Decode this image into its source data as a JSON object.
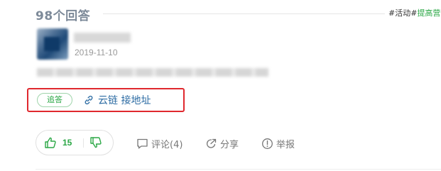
{
  "header": {
    "answers_title": "98个回答",
    "topic_activity": "#活动#",
    "topic_more": "提高营"
  },
  "answer": {
    "date": "2019-11-10",
    "follow_tag": "追答",
    "link_text": "云链 接地址"
  },
  "actions": {
    "upvote_count": "15",
    "comment_label": "评论(4)",
    "share_label": "分享",
    "report_label": "举报"
  },
  "colors": {
    "accent_green": "#2aa745",
    "link_blue": "#2e6da4",
    "highlight_red": "#e0282e",
    "title_gray": "#7d8a99"
  },
  "icons": {
    "link": "link-icon",
    "upvote": "thumbs-up-icon",
    "downvote": "thumbs-down-icon",
    "comment": "comment-icon",
    "share": "share-icon",
    "report": "report-icon"
  }
}
